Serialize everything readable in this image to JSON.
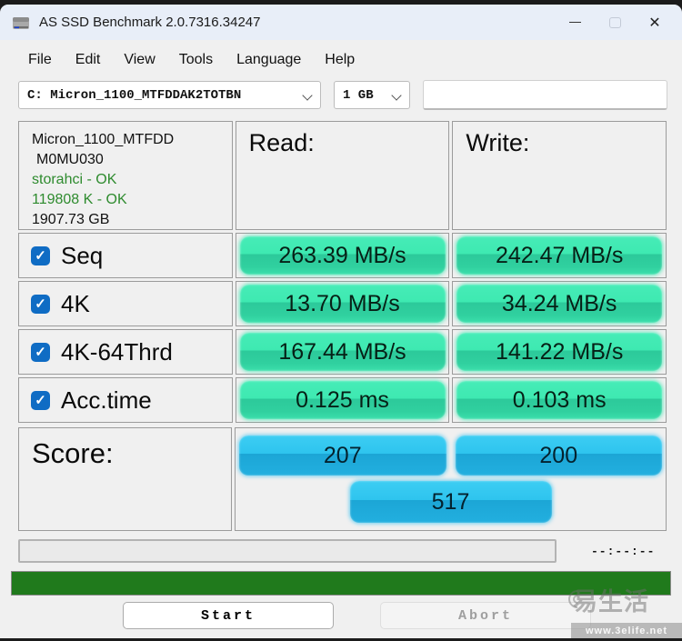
{
  "window": {
    "title": "AS SSD Benchmark 2.0.7316.34247"
  },
  "icons": {
    "app": "hard-drive-icon",
    "minimize": "—",
    "close": "✕",
    "checkmark": "✓"
  },
  "menu": {
    "items": [
      "File",
      "Edit",
      "View",
      "Tools",
      "Language",
      "Help"
    ]
  },
  "toolbar": {
    "drive_select": "C: Micron_1100_MTFDDAK2TOTBN",
    "size_select": "1 GB"
  },
  "drive_info": {
    "model_line1": "Micron_1100_MTFDD",
    "model_line2": "M0MU030",
    "driver_status": "storahci - OK",
    "alignment_status": "119808 K - OK",
    "capacity": "1907.73 GB"
  },
  "results": {
    "read_header": "Read:",
    "write_header": "Write:",
    "rows": [
      {
        "label": "Seq",
        "checked": true,
        "read": "263.39 MB/s",
        "write": "242.47 MB/s"
      },
      {
        "label": "4K",
        "checked": true,
        "read": "13.70 MB/s",
        "write": "34.24 MB/s"
      },
      {
        "label": "4K-64Thrd",
        "checked": true,
        "read": "167.44 MB/s",
        "write": "141.22 MB/s"
      },
      {
        "label": "Acc.time",
        "checked": true,
        "read": "0.125 ms",
        "write": "0.103 ms"
      }
    ]
  },
  "score": {
    "label": "Score:",
    "read_score": "207",
    "write_score": "200",
    "total_score": "517"
  },
  "status": {
    "time_remaining": "--:--:--"
  },
  "buttons": {
    "start": "Start",
    "abort": "Abort"
  },
  "watermark": {
    "logo_text": "易生活",
    "url": "www.3elife.net"
  },
  "colors": {
    "titlebar_bg": "#e8eef8",
    "window_bg": "#f0f0f0",
    "green_pill": "#3ee9b1",
    "blue_pill": "#2ec4ee",
    "checkbox_blue": "#0f6cc4",
    "status_text_green": "#2e8b2e",
    "progress_green": "#207a1c"
  }
}
